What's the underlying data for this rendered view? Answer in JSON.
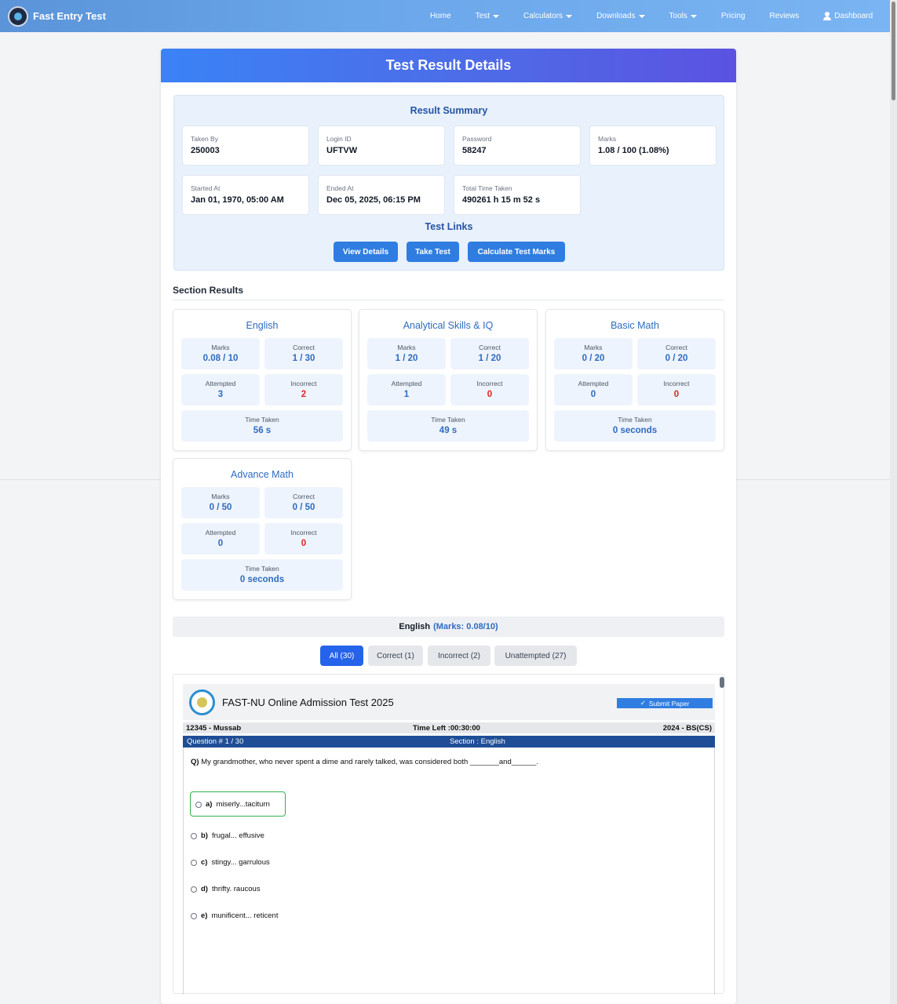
{
  "navbar": {
    "brand": "Fast Entry Test",
    "items": [
      {
        "label": "Home",
        "dropdown": false
      },
      {
        "label": "Test",
        "dropdown": true
      },
      {
        "label": "Calculators",
        "dropdown": true
      },
      {
        "label": "Downloads",
        "dropdown": true
      },
      {
        "label": "Tools",
        "dropdown": true
      },
      {
        "label": "Pricing",
        "dropdown": false
      },
      {
        "label": "Reviews",
        "dropdown": false
      },
      {
        "label": "Dashboard",
        "icon": "user-icon"
      }
    ]
  },
  "page": {
    "title": "Test Result Details"
  },
  "summary": {
    "title": "Result Summary",
    "taken_by": {
      "label": "Taken By",
      "value": "250003"
    },
    "login_id": {
      "label": "Login ID",
      "value": "UFTVW"
    },
    "password": {
      "label": "Password",
      "value": "58247"
    },
    "marks": {
      "label": "Marks",
      "value": "1.08 / 100 (1.08%)"
    },
    "started_at": {
      "label": "Started At",
      "value": "Jan 01, 1970, 05:00 AM"
    },
    "ended_at": {
      "label": "Ended At",
      "value": "Dec 05, 2025, 06:15 PM"
    },
    "total_time": {
      "label": "Total Time Taken",
      "value": "490261 h 15 m 52 s"
    }
  },
  "links": {
    "title": "Test Links",
    "view_details": "View Details",
    "take_test": "Take Test",
    "calculate": "Calculate Test Marks"
  },
  "section_results": {
    "title": "Section Results",
    "labels": {
      "marks": "Marks",
      "correct": "Correct",
      "attempted": "Attempted",
      "incorrect": "Incorrect",
      "time": "Time Taken"
    },
    "sections": [
      {
        "name": "English",
        "marks": "0.08 / 10",
        "correct": "1 / 30",
        "attempted": "3",
        "incorrect": "2",
        "time": "56 s"
      },
      {
        "name": "Analytical Skills & IQ",
        "marks": "1 / 20",
        "correct": "1 / 20",
        "attempted": "1",
        "incorrect": "0",
        "time": "49 s"
      },
      {
        "name": "Basic Math",
        "marks": "0 / 20",
        "correct": "0 / 20",
        "attempted": "0",
        "incorrect": "0",
        "time": "0 seconds"
      },
      {
        "name": "Advance Math",
        "marks": "0 / 50",
        "correct": "0 / 50",
        "attempted": "0",
        "incorrect": "0",
        "time": "0 seconds"
      }
    ]
  },
  "subject_view": {
    "subject": "English",
    "marks_text": "(Marks: 0.08/10)",
    "filters": [
      "All (30)",
      "Correct (1)",
      "Incorrect (2)",
      "Unattempted (27)"
    ],
    "active_filter": "All (30)"
  },
  "question": {
    "exam_title": "FAST-NU Online Admission Test 2025",
    "submit_label": "Submit Paper",
    "candidate": "12345 - Mussab",
    "time_left": "Time Left :00:30:00",
    "program": "2024 - BS(CS)",
    "number": "Question # 1 / 30",
    "section": "Section : English",
    "text_prefix": "Q)",
    "text": "My grandmother, who never spent a dime and rarely talked, was considered both _______and______.",
    "options": [
      {
        "key": "a)",
        "text": "miserly...taciturn",
        "correct": true
      },
      {
        "key": "b)",
        "text": "frugal... effusive",
        "correct": false
      },
      {
        "key": "c)",
        "text": "stingy... garrulous",
        "correct": false
      },
      {
        "key": "d)",
        "text": "thrifty. raucous",
        "correct": false
      },
      {
        "key": "e)",
        "text": "munificent... reticent",
        "correct": false
      }
    ]
  },
  "colors": {
    "accent": "#2f7de1",
    "heading_blue": "#2553a3",
    "correct_green": "#36b04e",
    "incorrect_red": "#dc2626"
  }
}
